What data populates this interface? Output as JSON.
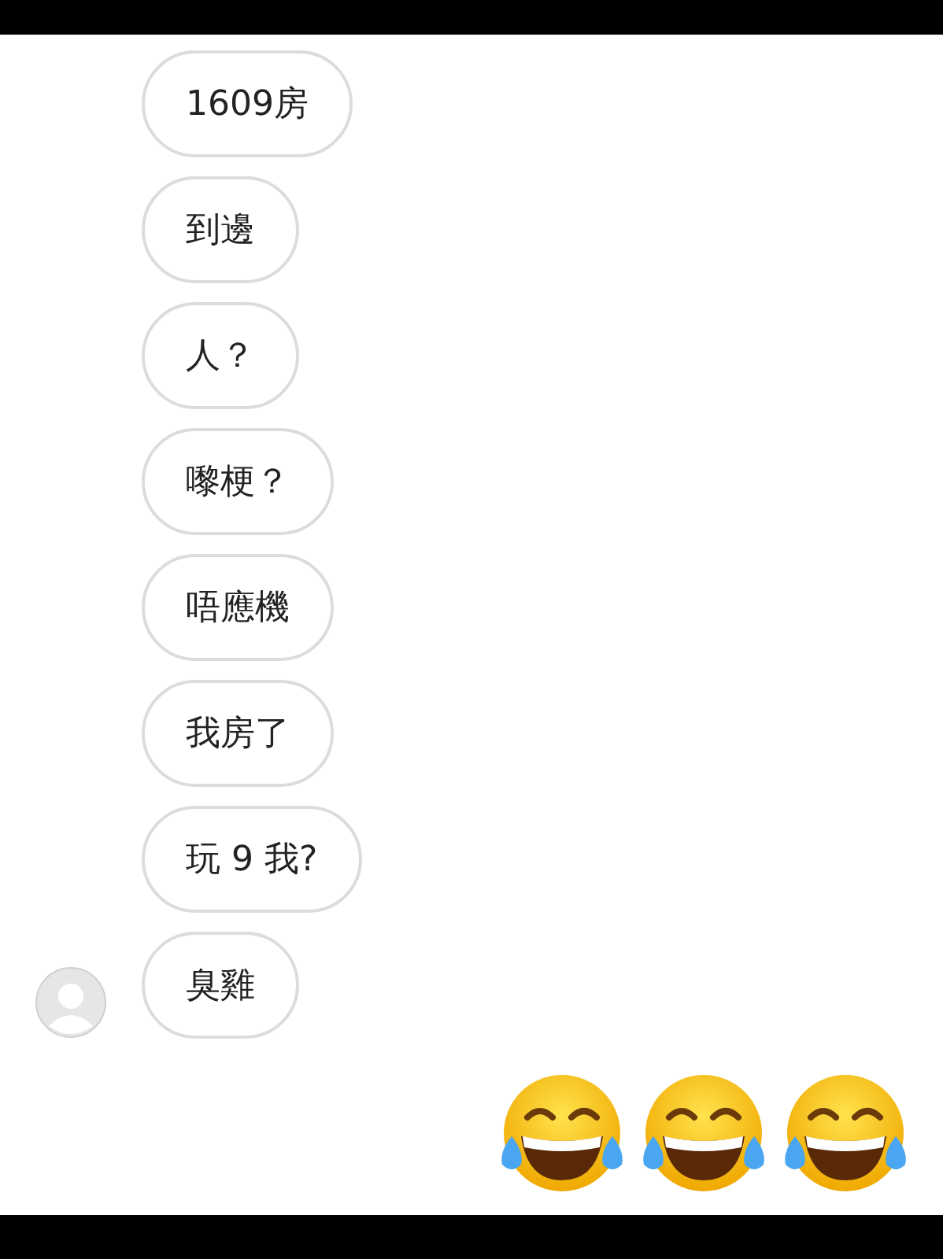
{
  "messages": [
    {
      "kind": "text",
      "outgoing": false,
      "text": "1609房"
    },
    {
      "kind": "text",
      "outgoing": false,
      "text": "到邊"
    },
    {
      "kind": "text",
      "outgoing": false,
      "text": "人？"
    },
    {
      "kind": "text",
      "outgoing": false,
      "text": "嚟梗？"
    },
    {
      "kind": "text",
      "outgoing": false,
      "text": "唔應機"
    },
    {
      "kind": "text",
      "outgoing": false,
      "text": "我房了"
    },
    {
      "kind": "text",
      "outgoing": false,
      "text": "玩 9 我?"
    },
    {
      "kind": "text",
      "outgoing": false,
      "text": "臭雞"
    },
    {
      "kind": "emoji",
      "outgoing": true,
      "emojis": [
        {
          "kind": "tears_of_joy"
        },
        {
          "kind": "tears_of_joy"
        },
        {
          "kind": "tears_of_joy"
        }
      ]
    }
  ]
}
